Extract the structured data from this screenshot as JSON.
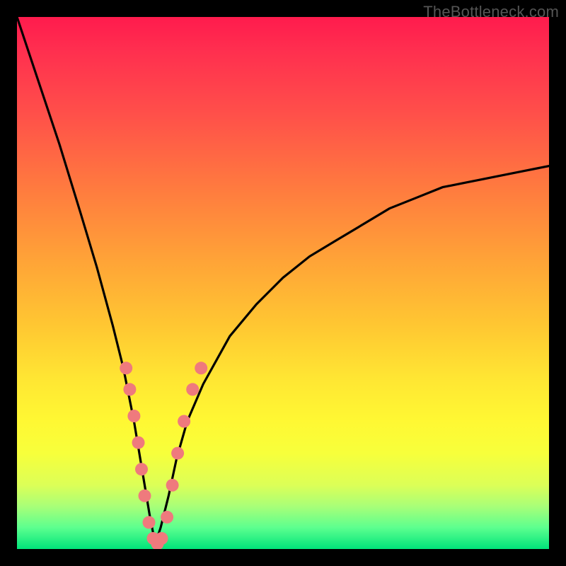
{
  "watermark": "TheBottleneck.com",
  "colors": {
    "frame_border": "#000000",
    "curve_stroke": "#000000",
    "dot_fill": "#ef7a7d",
    "dot_stroke": "#c85b5e",
    "gradient_top": "#ff1b4d",
    "gradient_bottom": "#00e47a"
  },
  "chart_data": {
    "type": "line",
    "title": "",
    "xlabel": "",
    "ylabel": "",
    "xlim": [
      0,
      100
    ],
    "ylim": [
      0,
      100
    ],
    "note": "V-shaped bottleneck curve. Minimum (≈0) near x≈26. y rises to ~100 at x=0 and ~72 at x=100. Axis values approximate (no ticks shown).",
    "series": [
      {
        "name": "bottleneck-curve",
        "x": [
          0,
          4,
          8,
          12,
          15,
          18,
          20,
          22,
          23.5,
          25,
          26,
          27,
          28.5,
          30,
          32,
          35,
          40,
          45,
          50,
          55,
          60,
          65,
          70,
          75,
          80,
          85,
          90,
          95,
          100
        ],
        "y": [
          100,
          88,
          76,
          63,
          53,
          42,
          34,
          24,
          15,
          6,
          1,
          4,
          10,
          17,
          24,
          31,
          40,
          46,
          51,
          55,
          58,
          61,
          64,
          66,
          68,
          69,
          70,
          71,
          72
        ]
      }
    ],
    "highlight_dots": {
      "name": "system-configuration-dots",
      "points": [
        {
          "x": 20.5,
          "y": 34
        },
        {
          "x": 21.2,
          "y": 30
        },
        {
          "x": 22.0,
          "y": 25
        },
        {
          "x": 22.8,
          "y": 20
        },
        {
          "x": 23.4,
          "y": 15
        },
        {
          "x": 24.0,
          "y": 10
        },
        {
          "x": 24.8,
          "y": 5
        },
        {
          "x": 25.6,
          "y": 2
        },
        {
          "x": 26.4,
          "y": 1
        },
        {
          "x": 27.2,
          "y": 2
        },
        {
          "x": 28.2,
          "y": 6
        },
        {
          "x": 29.2,
          "y": 12
        },
        {
          "x": 30.2,
          "y": 18
        },
        {
          "x": 31.4,
          "y": 24
        },
        {
          "x": 33.0,
          "y": 30
        },
        {
          "x": 34.6,
          "y": 34
        }
      ]
    }
  }
}
